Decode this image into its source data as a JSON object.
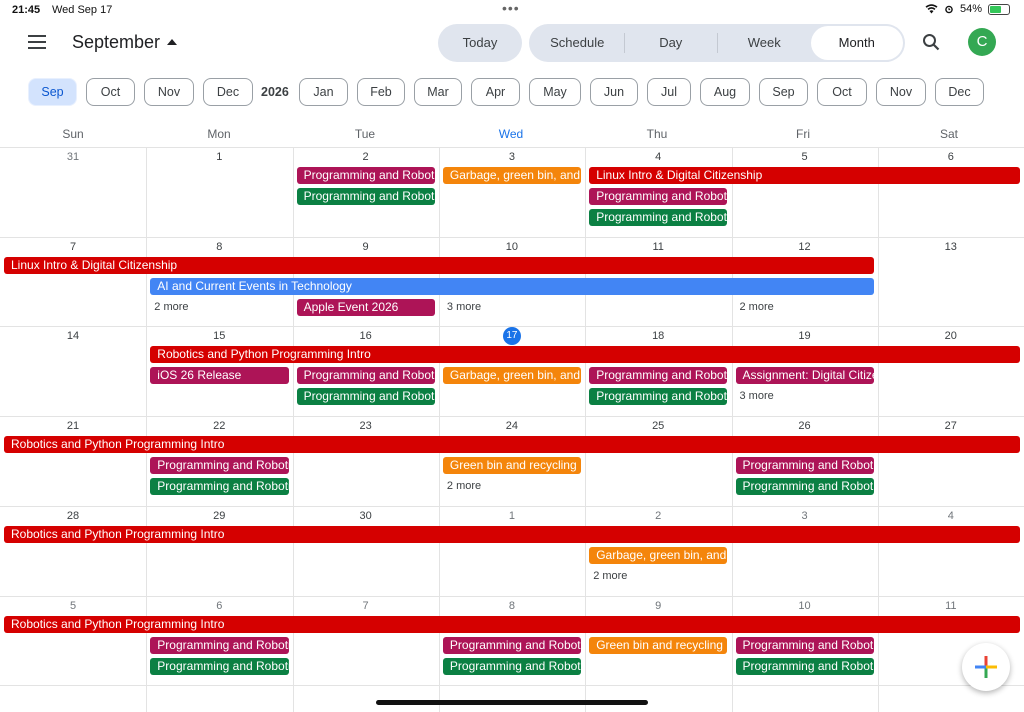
{
  "status": {
    "time": "21:45",
    "date": "Wed Sep 17",
    "battery": "54%"
  },
  "header": {
    "month": "September",
    "today": "Today",
    "views": [
      "Schedule",
      "Day",
      "Week",
      "Month"
    ],
    "active_view": "Month",
    "avatar": "C"
  },
  "month_strip": {
    "first": "Sep",
    "year": "2026",
    "months": [
      "Oct",
      "Nov",
      "Dec",
      "Jan",
      "Feb",
      "Mar",
      "Apr",
      "May",
      "Jun",
      "Jul",
      "Aug",
      "Sep",
      "Oct",
      "Nov",
      "Dec"
    ]
  },
  "weekdays": [
    "Sun",
    "Mon",
    "Tue",
    "Wed",
    "Thu",
    "Fri",
    "Sat"
  ],
  "weeks": [
    [
      "31",
      "1",
      "2",
      "3",
      "4",
      "5",
      "6"
    ],
    [
      "7",
      "8",
      "9",
      "10",
      "11",
      "12",
      "13"
    ],
    [
      "14",
      "15",
      "16",
      "17",
      "18",
      "19",
      "20"
    ],
    [
      "21",
      "22",
      "23",
      "24",
      "25",
      "26",
      "27"
    ],
    [
      "28",
      "29",
      "30",
      "1",
      "2",
      "3",
      "4"
    ],
    [
      "5",
      "6",
      "7",
      "8",
      "9",
      "10",
      "11"
    ]
  ],
  "other_month": [
    [
      0,
      0
    ],
    [
      4,
      3
    ],
    [
      4,
      4
    ],
    [
      4,
      5
    ],
    [
      4,
      6
    ],
    [
      5,
      0
    ],
    [
      5,
      1
    ],
    [
      5,
      2
    ],
    [
      5,
      3
    ],
    [
      5,
      4
    ],
    [
      5,
      5
    ],
    [
      5,
      6
    ]
  ],
  "today": [
    2,
    3
  ],
  "colors": {
    "red": "#d50000",
    "magenta": "#ad1457",
    "green": "#0b8043",
    "orange": "#f4850b",
    "blue": "#4285f4"
  },
  "events": [
    {
      "w": 0,
      "d": 2,
      "span": 1,
      "lane": 0,
      "c": "magenta",
      "t": "Programming and Robotics"
    },
    {
      "w": 0,
      "d": 2,
      "span": 1,
      "lane": 1,
      "c": "green",
      "t": "Programming and Robotics"
    },
    {
      "w": 0,
      "d": 3,
      "span": 1,
      "lane": 0,
      "c": "orange",
      "t": "Garbage, green bin, and recycling"
    },
    {
      "w": 0,
      "d": 4,
      "span": 3,
      "lane": 0,
      "c": "red",
      "t": "Linux Intro & Digital Citizenship"
    },
    {
      "w": 0,
      "d": 4,
      "span": 1,
      "lane": 1,
      "c": "magenta",
      "t": "Programming and Robotics"
    },
    {
      "w": 0,
      "d": 4,
      "span": 1,
      "lane": 2,
      "c": "green",
      "t": "Programming and Robotics"
    },
    {
      "w": 1,
      "d": 0,
      "span": 6,
      "lane": 0,
      "c": "red",
      "t": "Linux Intro & Digital Citizenship"
    },
    {
      "w": 1,
      "d": 1,
      "span": 5,
      "lane": 1,
      "c": "blue",
      "t": "AI and Current Events in Technology"
    },
    {
      "w": 1,
      "d": 2,
      "span": 1,
      "lane": 2,
      "c": "magenta",
      "t": "Apple Event 2026"
    },
    {
      "w": 2,
      "d": 1,
      "span": 6,
      "lane": 0,
      "c": "red",
      "t": "Robotics and Python Programming Intro"
    },
    {
      "w": 2,
      "d": 1,
      "span": 1,
      "lane": 1,
      "c": "magenta",
      "t": "iOS 26 Release"
    },
    {
      "w": 2,
      "d": 2,
      "span": 1,
      "lane": 1,
      "c": "magenta",
      "t": "Programming and Robotics"
    },
    {
      "w": 2,
      "d": 2,
      "span": 1,
      "lane": 2,
      "c": "green",
      "t": "Programming and Robotics"
    },
    {
      "w": 2,
      "d": 3,
      "span": 1,
      "lane": 1,
      "c": "orange",
      "t": "Garbage, green bin, and recycling"
    },
    {
      "w": 2,
      "d": 4,
      "span": 1,
      "lane": 1,
      "c": "magenta",
      "t": "Programming and Robotics"
    },
    {
      "w": 2,
      "d": 4,
      "span": 1,
      "lane": 2,
      "c": "green",
      "t": "Programming and Robotics"
    },
    {
      "w": 2,
      "d": 5,
      "span": 1,
      "lane": 1,
      "c": "magenta",
      "t": "Assignment: Digital Citizenship"
    },
    {
      "w": 3,
      "d": 0,
      "span": 7,
      "lane": 0,
      "c": "red",
      "t": "Robotics and Python Programming Intro"
    },
    {
      "w": 3,
      "d": 1,
      "span": 1,
      "lane": 1,
      "c": "magenta",
      "t": "Programming and Robotics"
    },
    {
      "w": 3,
      "d": 1,
      "span": 1,
      "lane": 2,
      "c": "green",
      "t": "Programming and Robotics"
    },
    {
      "w": 3,
      "d": 3,
      "span": 1,
      "lane": 1,
      "c": "orange",
      "t": "Green bin and recycling"
    },
    {
      "w": 3,
      "d": 5,
      "span": 1,
      "lane": 1,
      "c": "magenta",
      "t": "Programming and Robotics"
    },
    {
      "w": 3,
      "d": 5,
      "span": 1,
      "lane": 2,
      "c": "green",
      "t": "Programming and Robotics"
    },
    {
      "w": 4,
      "d": 0,
      "span": 7,
      "lane": 0,
      "c": "red",
      "t": "Robotics and Python Programming Intro"
    },
    {
      "w": 4,
      "d": 4,
      "span": 1,
      "lane": 1,
      "c": "orange",
      "t": "Garbage, green bin, and recycling"
    },
    {
      "w": 5,
      "d": 0,
      "span": 7,
      "lane": 0,
      "c": "red",
      "t": "Robotics and Python Programming Intro"
    },
    {
      "w": 5,
      "d": 1,
      "span": 1,
      "lane": 1,
      "c": "magenta",
      "t": "Programming and Robotics"
    },
    {
      "w": 5,
      "d": 1,
      "span": 1,
      "lane": 2,
      "c": "green",
      "t": "Programming and Robotics"
    },
    {
      "w": 5,
      "d": 3,
      "span": 1,
      "lane": 1,
      "c": "magenta",
      "t": "Programming and Robotics"
    },
    {
      "w": 5,
      "d": 3,
      "span": 1,
      "lane": 2,
      "c": "green",
      "t": "Programming and Robotics"
    },
    {
      "w": 5,
      "d": 4,
      "span": 1,
      "lane": 1,
      "c": "orange",
      "t": "Green bin and recycling"
    },
    {
      "w": 5,
      "d": 5,
      "span": 1,
      "lane": 1,
      "c": "magenta",
      "t": "Programming and Robotics"
    },
    {
      "w": 5,
      "d": 5,
      "span": 1,
      "lane": 2,
      "c": "green",
      "t": "Programming and Robotics"
    }
  ],
  "more": [
    {
      "w": 1,
      "d": 1,
      "lane": 2,
      "t": "2 more"
    },
    {
      "w": 1,
      "d": 3,
      "lane": 2,
      "t": "3 more"
    },
    {
      "w": 1,
      "d": 5,
      "lane": 2,
      "t": "2 more"
    },
    {
      "w": 2,
      "d": 5,
      "lane": 2,
      "t": "3 more"
    },
    {
      "w": 3,
      "d": 3,
      "lane": 2,
      "t": "2 more"
    },
    {
      "w": 4,
      "d": 4,
      "lane": 2,
      "t": "2 more"
    }
  ]
}
